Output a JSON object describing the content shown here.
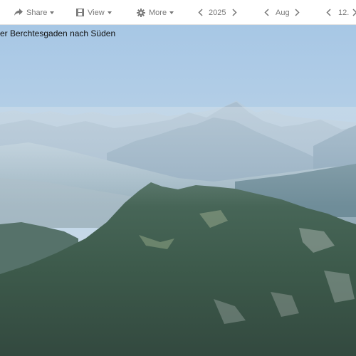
{
  "toolbar": {
    "share_label": "Share",
    "view_label": "View",
    "more_label": "More",
    "year": "2025",
    "month": "Aug",
    "day": "12."
  },
  "photo": {
    "caption": "er Berchtesgaden nach Süden"
  },
  "colors": {
    "toolbar_text": "#777777",
    "sky_top": "#a9c9e6",
    "sky_bottom": "#d9e4ec",
    "forest": "#3d5a4b"
  },
  "icons": {
    "share": "share-arrow-icon",
    "view": "film-frame-icon",
    "more": "gear-icon",
    "prev": "chevron-left-icon",
    "next": "chevron-right-icon"
  }
}
